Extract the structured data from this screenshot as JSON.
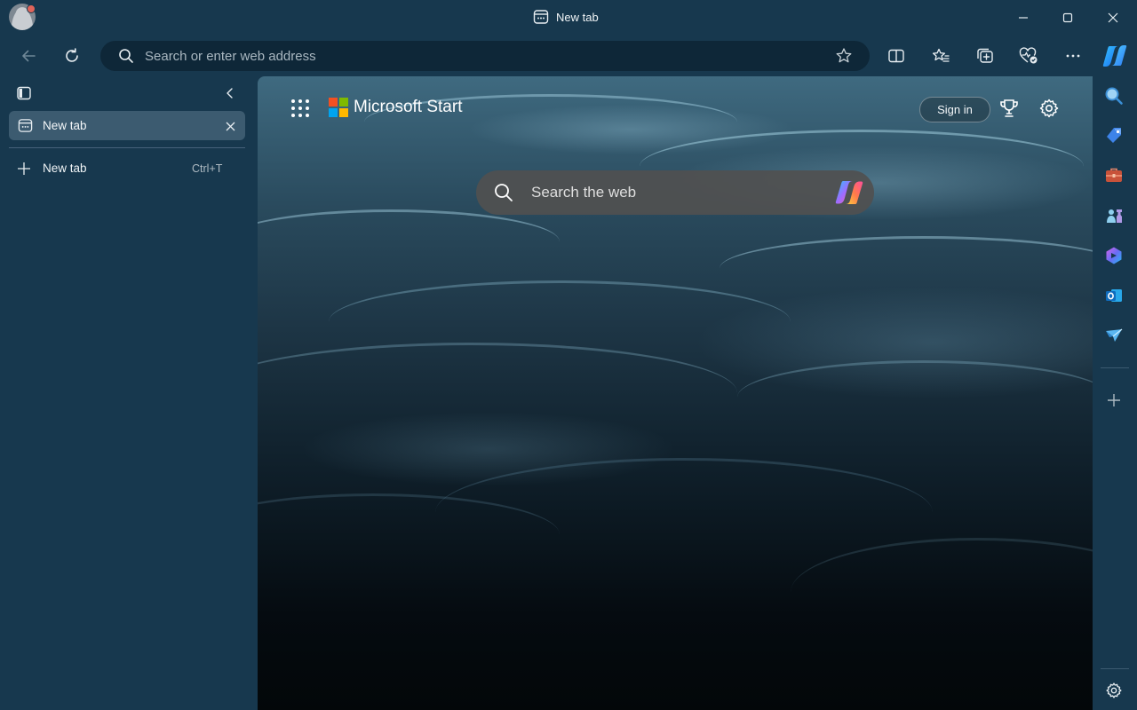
{
  "window": {
    "title": "New tab"
  },
  "address_bar": {
    "placeholder": "Search or enter web address"
  },
  "vertical_tabs": {
    "tabs": [
      {
        "label": "New tab",
        "active": true
      }
    ],
    "new_tab": {
      "label": "New tab",
      "shortcut": "Ctrl+T"
    }
  },
  "new_tab_page": {
    "brand": "Microsoft Start",
    "sign_in_label": "Sign in",
    "search_placeholder": "Search the web"
  },
  "colors": {
    "chrome": "#17384e",
    "address_bar": "#0e2738",
    "active_tab": "#3c5b70",
    "search_box": "#505050"
  },
  "icons": {
    "toolbar": [
      "back-icon",
      "refresh-icon",
      "search-icon",
      "star-icon",
      "split-screen-icon",
      "favorites-icon",
      "collections-icon",
      "browser-essentials-icon",
      "more-icon",
      "copilot-icon"
    ],
    "right_sidebar": [
      "search-icon",
      "shopping-tag-icon",
      "tools-icon",
      "games-icon",
      "microsoft-365-icon",
      "outlook-icon",
      "drop-icon",
      "add-icon",
      "settings-icon"
    ]
  }
}
